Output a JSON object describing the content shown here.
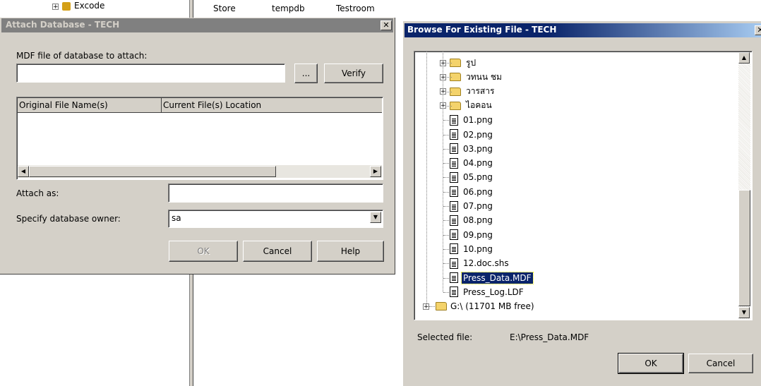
{
  "background": {
    "tree_item_label": "Excode",
    "columns": [
      "Store",
      "tempdb",
      "Testroom"
    ]
  },
  "attach_dialog": {
    "title": "Attach Database - TECH",
    "mdf_label": "MDF file of database to attach:",
    "mdf_value": "",
    "browse_label": "...",
    "verify_label": "Verify",
    "table_headers": [
      "Original File Name(s)",
      "Current File(s) Location"
    ],
    "attach_as_label": "Attach as:",
    "attach_as_value": "",
    "owner_label": "Specify database owner:",
    "owner_value": "sa",
    "ok_label": "OK",
    "cancel_label": "Cancel",
    "help_label": "Help"
  },
  "browse_dialog": {
    "title": "Browse For Existing File - TECH",
    "tree": [
      {
        "label": "รูป",
        "type": "folder"
      },
      {
        "label": "วทนน ชม",
        "type": "folder"
      },
      {
        "label": "วารสาร",
        "type": "folder"
      },
      {
        "label": "ไอคอน",
        "type": "folder"
      },
      {
        "label": "01.png",
        "type": "file"
      },
      {
        "label": "02.png",
        "type": "file"
      },
      {
        "label": "03.png",
        "type": "file"
      },
      {
        "label": "04.png",
        "type": "file"
      },
      {
        "label": "05.png",
        "type": "file"
      },
      {
        "label": "06.png",
        "type": "file"
      },
      {
        "label": "07.png",
        "type": "file"
      },
      {
        "label": "08.png",
        "type": "file"
      },
      {
        "label": "09.png",
        "type": "file"
      },
      {
        "label": "10.png",
        "type": "file"
      },
      {
        "label": "12.doc.shs",
        "type": "file"
      },
      {
        "label": "Press_Data.MDF",
        "type": "file",
        "selected": true
      },
      {
        "label": "Press_Log.LDF",
        "type": "file"
      }
    ],
    "drive_label": "G:\\ (11701 MB free)",
    "selected_label": "Selected file:",
    "selected_value": "E:\\Press_Data.MDF",
    "ok_label": "OK",
    "cancel_label": "Cancel"
  },
  "colors": {
    "dialog_face": "#d4d0c8",
    "selection": "#0a246a",
    "inactive_title": "#808080"
  }
}
